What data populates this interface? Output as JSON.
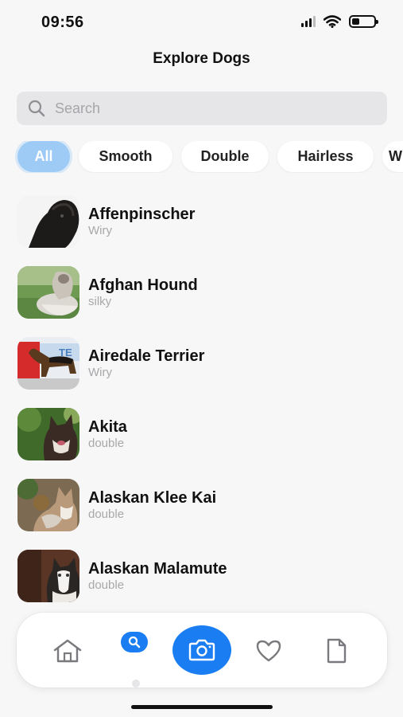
{
  "status_bar": {
    "time": "09:56",
    "battery_level": 0.35
  },
  "header": {
    "title": "Explore Dogs"
  },
  "search": {
    "placeholder": "Search",
    "icon": "search-icon"
  },
  "filters": [
    {
      "label": "All",
      "active": true
    },
    {
      "label": "Smooth",
      "active": false
    },
    {
      "label": "Double",
      "active": false
    },
    {
      "label": "Hairless",
      "active": false
    },
    {
      "label": "W",
      "active": false
    }
  ],
  "dogs": [
    {
      "name": "Affenpinscher",
      "coat": "Wiry"
    },
    {
      "name": "Afghan Hound",
      "coat": "silky"
    },
    {
      "name": "Airedale Terrier",
      "coat": "Wiry"
    },
    {
      "name": "Akita",
      "coat": "double"
    },
    {
      "name": "Alaskan Klee Kai",
      "coat": "double"
    },
    {
      "name": "Alaskan Malamute",
      "coat": "double"
    }
  ],
  "thumbnail_banner_text": "TE",
  "nav": {
    "items": [
      "home-icon",
      "search-icon",
      "camera-icon",
      "heart-icon",
      "document-icon"
    ],
    "active": "search-icon"
  },
  "colors": {
    "accent": "#1a7ef2",
    "chip_active": "#9ecbf6",
    "background": "#f7f7f8"
  }
}
